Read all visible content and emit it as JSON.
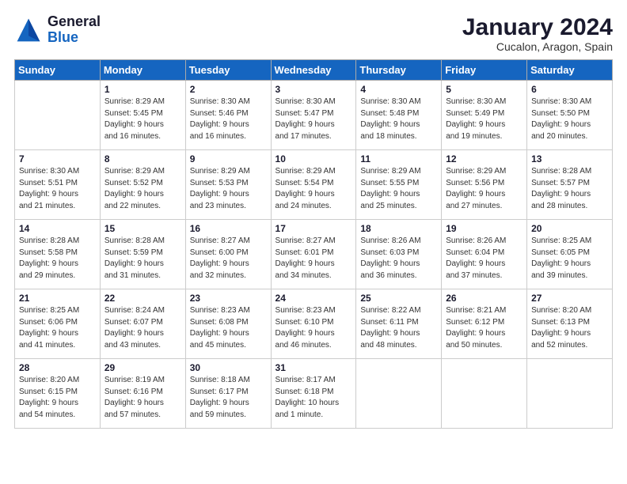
{
  "logo": {
    "general": "General",
    "blue": "Blue"
  },
  "title": "January 2024",
  "subtitle": "Cucalon, Aragon, Spain",
  "days_header": [
    "Sunday",
    "Monday",
    "Tuesday",
    "Wednesday",
    "Thursday",
    "Friday",
    "Saturday"
  ],
  "weeks": [
    [
      {
        "day": "",
        "info": ""
      },
      {
        "day": "1",
        "info": "Sunrise: 8:29 AM\nSunset: 5:45 PM\nDaylight: 9 hours\nand 16 minutes."
      },
      {
        "day": "2",
        "info": "Sunrise: 8:30 AM\nSunset: 5:46 PM\nDaylight: 9 hours\nand 16 minutes."
      },
      {
        "day": "3",
        "info": "Sunrise: 8:30 AM\nSunset: 5:47 PM\nDaylight: 9 hours\nand 17 minutes."
      },
      {
        "day": "4",
        "info": "Sunrise: 8:30 AM\nSunset: 5:48 PM\nDaylight: 9 hours\nand 18 minutes."
      },
      {
        "day": "5",
        "info": "Sunrise: 8:30 AM\nSunset: 5:49 PM\nDaylight: 9 hours\nand 19 minutes."
      },
      {
        "day": "6",
        "info": "Sunrise: 8:30 AM\nSunset: 5:50 PM\nDaylight: 9 hours\nand 20 minutes."
      }
    ],
    [
      {
        "day": "7",
        "info": "Sunrise: 8:30 AM\nSunset: 5:51 PM\nDaylight: 9 hours\nand 21 minutes."
      },
      {
        "day": "8",
        "info": "Sunrise: 8:29 AM\nSunset: 5:52 PM\nDaylight: 9 hours\nand 22 minutes."
      },
      {
        "day": "9",
        "info": "Sunrise: 8:29 AM\nSunset: 5:53 PM\nDaylight: 9 hours\nand 23 minutes."
      },
      {
        "day": "10",
        "info": "Sunrise: 8:29 AM\nSunset: 5:54 PM\nDaylight: 9 hours\nand 24 minutes."
      },
      {
        "day": "11",
        "info": "Sunrise: 8:29 AM\nSunset: 5:55 PM\nDaylight: 9 hours\nand 25 minutes."
      },
      {
        "day": "12",
        "info": "Sunrise: 8:29 AM\nSunset: 5:56 PM\nDaylight: 9 hours\nand 27 minutes."
      },
      {
        "day": "13",
        "info": "Sunrise: 8:28 AM\nSunset: 5:57 PM\nDaylight: 9 hours\nand 28 minutes."
      }
    ],
    [
      {
        "day": "14",
        "info": "Sunrise: 8:28 AM\nSunset: 5:58 PM\nDaylight: 9 hours\nand 29 minutes."
      },
      {
        "day": "15",
        "info": "Sunrise: 8:28 AM\nSunset: 5:59 PM\nDaylight: 9 hours\nand 31 minutes."
      },
      {
        "day": "16",
        "info": "Sunrise: 8:27 AM\nSunset: 6:00 PM\nDaylight: 9 hours\nand 32 minutes."
      },
      {
        "day": "17",
        "info": "Sunrise: 8:27 AM\nSunset: 6:01 PM\nDaylight: 9 hours\nand 34 minutes."
      },
      {
        "day": "18",
        "info": "Sunrise: 8:26 AM\nSunset: 6:03 PM\nDaylight: 9 hours\nand 36 minutes."
      },
      {
        "day": "19",
        "info": "Sunrise: 8:26 AM\nSunset: 6:04 PM\nDaylight: 9 hours\nand 37 minutes."
      },
      {
        "day": "20",
        "info": "Sunrise: 8:25 AM\nSunset: 6:05 PM\nDaylight: 9 hours\nand 39 minutes."
      }
    ],
    [
      {
        "day": "21",
        "info": "Sunrise: 8:25 AM\nSunset: 6:06 PM\nDaylight: 9 hours\nand 41 minutes."
      },
      {
        "day": "22",
        "info": "Sunrise: 8:24 AM\nSunset: 6:07 PM\nDaylight: 9 hours\nand 43 minutes."
      },
      {
        "day": "23",
        "info": "Sunrise: 8:23 AM\nSunset: 6:08 PM\nDaylight: 9 hours\nand 45 minutes."
      },
      {
        "day": "24",
        "info": "Sunrise: 8:23 AM\nSunset: 6:10 PM\nDaylight: 9 hours\nand 46 minutes."
      },
      {
        "day": "25",
        "info": "Sunrise: 8:22 AM\nSunset: 6:11 PM\nDaylight: 9 hours\nand 48 minutes."
      },
      {
        "day": "26",
        "info": "Sunrise: 8:21 AM\nSunset: 6:12 PM\nDaylight: 9 hours\nand 50 minutes."
      },
      {
        "day": "27",
        "info": "Sunrise: 8:20 AM\nSunset: 6:13 PM\nDaylight: 9 hours\nand 52 minutes."
      }
    ],
    [
      {
        "day": "28",
        "info": "Sunrise: 8:20 AM\nSunset: 6:15 PM\nDaylight: 9 hours\nand 54 minutes."
      },
      {
        "day": "29",
        "info": "Sunrise: 8:19 AM\nSunset: 6:16 PM\nDaylight: 9 hours\nand 57 minutes."
      },
      {
        "day": "30",
        "info": "Sunrise: 8:18 AM\nSunset: 6:17 PM\nDaylight: 9 hours\nand 59 minutes."
      },
      {
        "day": "31",
        "info": "Sunrise: 8:17 AM\nSunset: 6:18 PM\nDaylight: 10 hours\nand 1 minute."
      },
      {
        "day": "",
        "info": ""
      },
      {
        "day": "",
        "info": ""
      },
      {
        "day": "",
        "info": ""
      }
    ]
  ]
}
